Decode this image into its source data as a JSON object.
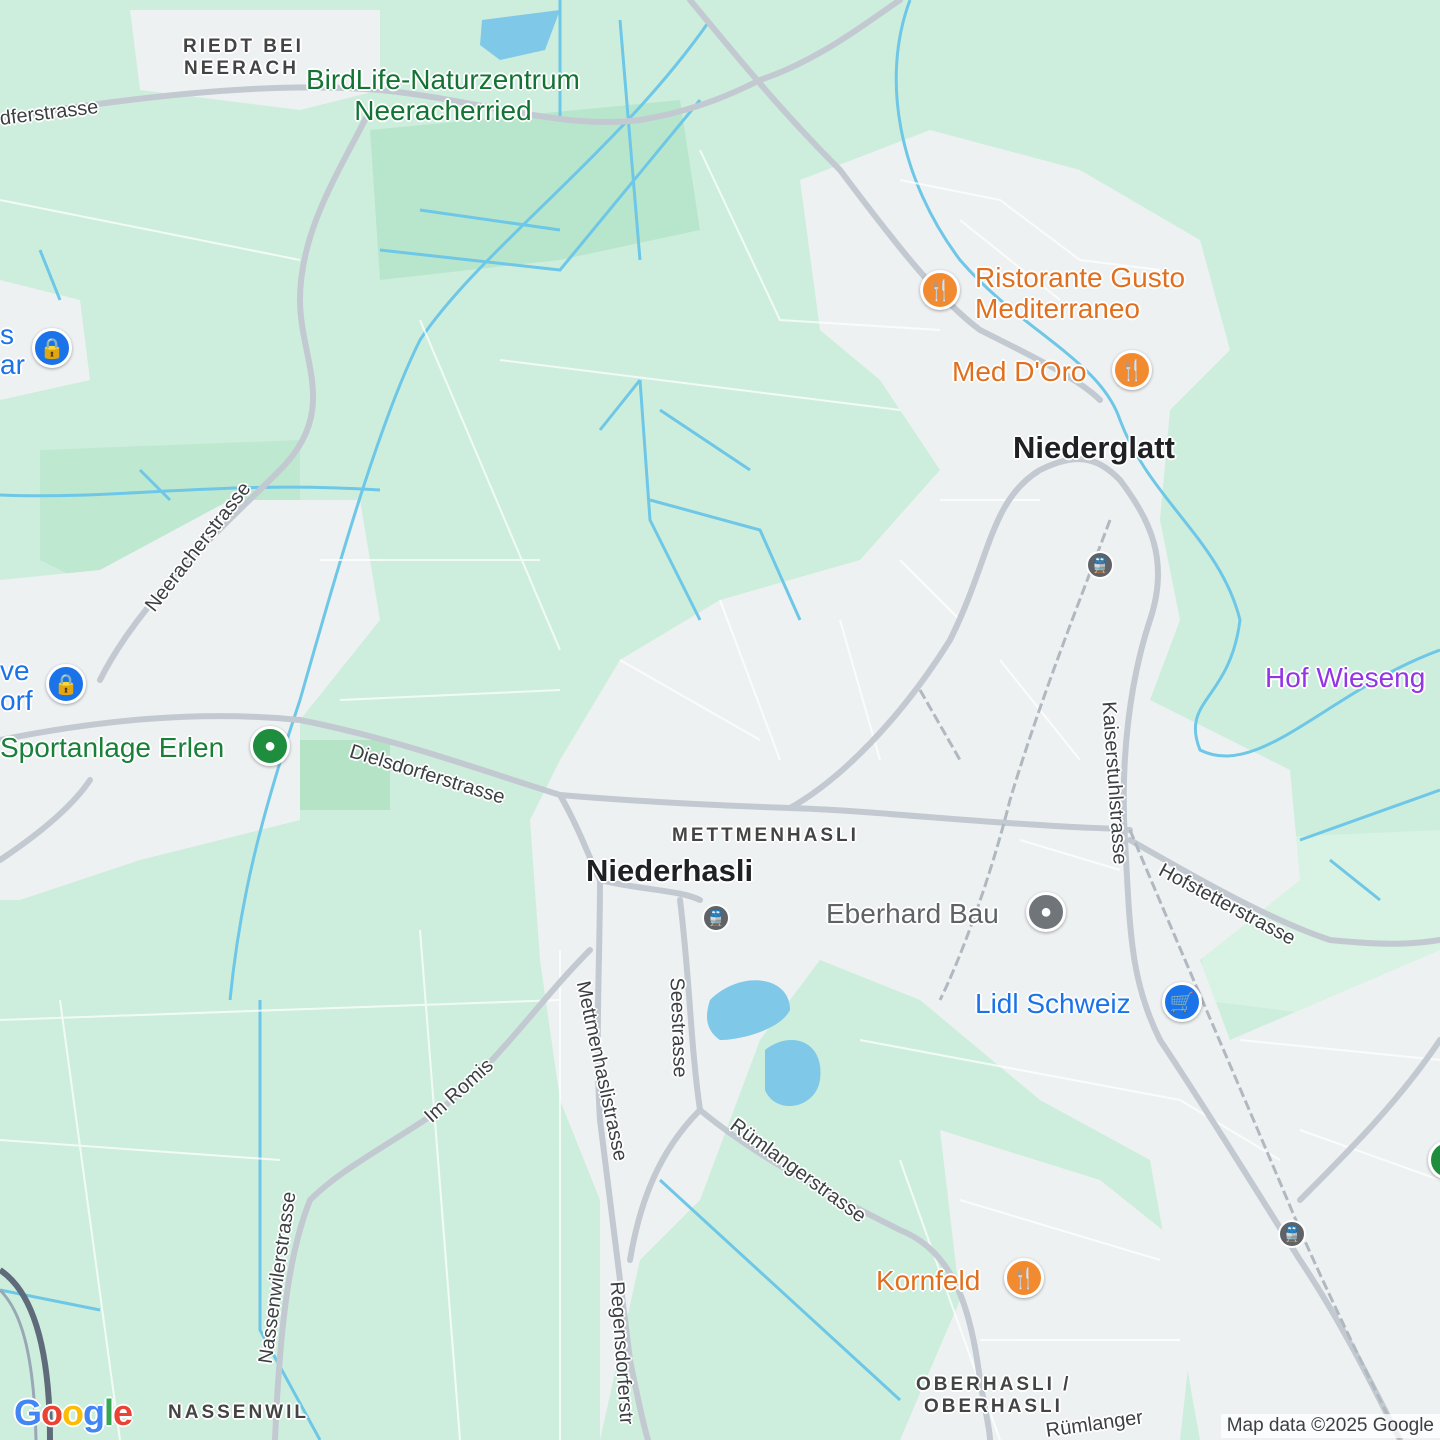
{
  "map": {
    "towns": {
      "niederglatt": "Niederglatt",
      "niederhasli": "Niederhasli"
    },
    "hamlets": {
      "riedt_line1": "RIEDT BEI",
      "riedt_line2": "NEERACH",
      "mettmenhasli": "METTMENHASLI",
      "nassenwil": "NASSENWIL",
      "oberhasli_line1": "OBERHASLI /",
      "oberhasli_line2": "OBERHASLI"
    },
    "streets": {
      "dorferstrasse": "dferstrasse",
      "neeracherstrasse": "Neeracherstrasse",
      "dielsdorferstrasse": "Dielsdorferstrasse",
      "kaiserstuhlstrasse": "Kaiserstuhlstrasse",
      "hofstetterstrasse": "Hofstetterstrasse",
      "seestrasse": "Seestrasse",
      "mettmenhaslistrasse": "Mettmenhaslistrasse",
      "im_romis": "Im Romis",
      "nassenwilerstrasse": "Nassenwilerstrasse",
      "ruemlangerstrasse": "Rümlangerstrasse",
      "regensdorferstrasse": "Regensdorferstr",
      "ruemlanger_bottom": "Rümlanger"
    },
    "pois": {
      "birdlife_line1": "BirdLife-Naturzentrum",
      "birdlife_line2": "Neeracherried",
      "ristorante_line1": "Ristorante Gusto",
      "ristorante_line2": "Mediterraneo",
      "med_doro": "Med D'Oro",
      "hof_wiesen": "Hof Wieseng",
      "sportanlage": "Sportanlage Erlen",
      "eberhard": "Eberhard Bau",
      "lidl": "Lidl Schweiz",
      "kornfeld": "Kornfeld",
      "left_top_line1": "s",
      "left_top_line2": "ar",
      "left_mid_line1": "ve",
      "left_mid_line2": "orf"
    },
    "icons": {
      "restaurant": "restaurant-icon",
      "shopping": "shopping-bag-icon",
      "cart": "shopping-cart-icon",
      "park": "park-icon",
      "place": "place-icon",
      "train": "train-station-icon"
    },
    "logo": "Google",
    "attribution": "Map data ©2025 Google",
    "colors": {
      "land": "#cdeedd",
      "urban": "#eef1f2",
      "water": "#7fc8e8",
      "road": "#c3c9d1",
      "restaurant": "#f28b30",
      "shop": "#1a73e8",
      "park": "#1e8e3e"
    }
  }
}
